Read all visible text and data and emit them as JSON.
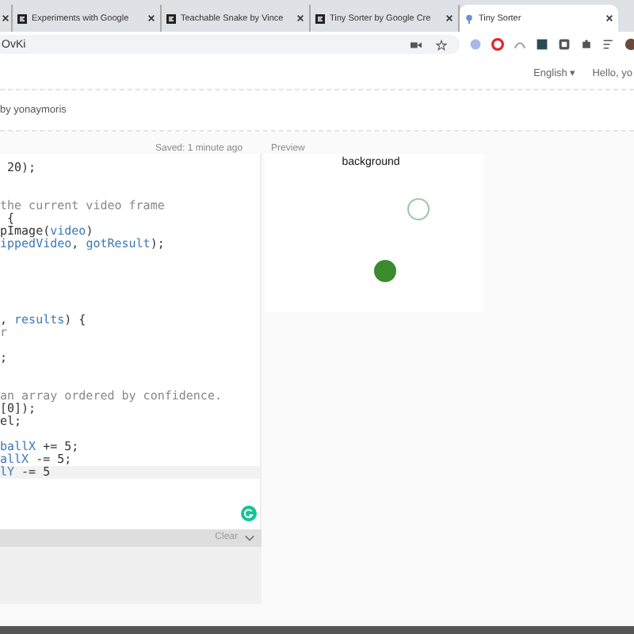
{
  "tabs": [
    {
      "selected": false
    },
    {
      "label": "Experiments with Google",
      "selected": false
    },
    {
      "label": "Teachable Snake by Vince",
      "selected": false
    },
    {
      "label": "Tiny Sorter by Google Cre",
      "selected": false
    },
    {
      "label": "Tiny Sorter",
      "selected": true
    }
  ],
  "address": "OvKi",
  "header": {
    "language": "English ▾",
    "greeting": "Hello, yo"
  },
  "sketch": {
    "author": "by yonaymoris",
    "saved": "Saved: 1 minute ago",
    "preview_label": "Preview"
  },
  "code_lines": [
    {
      "current": false,
      "segments": [
        {
          "kind": "plain",
          "text": " 20);"
        }
      ]
    },
    {
      "current": false
    },
    {
      "current": false
    },
    {
      "current": false,
      "segments": [
        {
          "kind": "comment",
          "text": "the current video frame"
        }
      ]
    },
    {
      "current": false,
      "segments": [
        {
          "kind": "plain",
          "text": " {"
        }
      ]
    },
    {
      "current": false,
      "segments": [
        {
          "kind": "plain",
          "text": "pImage("
        },
        {
          "kind": "ident",
          "text": "video"
        },
        {
          "kind": "plain",
          "text": ")"
        }
      ]
    },
    {
      "current": false,
      "segments": [
        {
          "kind": "ident",
          "text": "ippedVideo"
        },
        {
          "kind": "plain",
          "text": ", "
        },
        {
          "kind": "ident",
          "text": "gotResult"
        },
        {
          "kind": "plain",
          "text": ");"
        }
      ]
    },
    {
      "current": false
    },
    {
      "current": false
    },
    {
      "current": false
    },
    {
      "current": false
    },
    {
      "current": false
    },
    {
      "current": false,
      "segments": [
        {
          "kind": "plain",
          "text": ", "
        },
        {
          "kind": "ident",
          "text": "results"
        },
        {
          "kind": "plain",
          "text": ") {"
        }
      ]
    },
    {
      "current": false,
      "segments": [
        {
          "kind": "comment",
          "text": "r"
        }
      ]
    },
    {
      "current": false
    },
    {
      "current": false,
      "segments": [
        {
          "kind": "plain",
          "text": ";"
        }
      ]
    },
    {
      "current": false
    },
    {
      "current": false
    },
    {
      "current": false,
      "segments": [
        {
          "kind": "comment",
          "text": "an array ordered by confidence."
        }
      ]
    },
    {
      "current": false,
      "segments": [
        {
          "kind": "plain",
          "text": "[0]);"
        }
      ]
    },
    {
      "current": false,
      "segments": [
        {
          "kind": "plain",
          "text": "el;"
        }
      ]
    },
    {
      "current": false
    },
    {
      "current": false,
      "segments": [
        {
          "kind": "ident",
          "text": "ballX"
        },
        {
          "kind": "plain",
          "text": " += 5;"
        }
      ]
    },
    {
      "current": false,
      "segments": [
        {
          "kind": "ident",
          "text": "allX"
        },
        {
          "kind": "plain",
          "text": " -= 5;"
        }
      ]
    },
    {
      "current": true,
      "segments": [
        {
          "kind": "ident",
          "text": "lY"
        },
        {
          "kind": "plain",
          "text": " -= 5"
        }
      ]
    }
  ],
  "console": {
    "clear": "Clear"
  },
  "canvas": {
    "label": "background"
  }
}
